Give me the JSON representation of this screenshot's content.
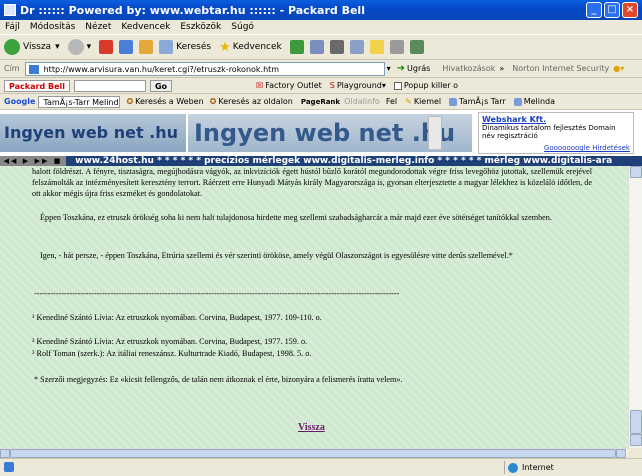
{
  "window": {
    "title": "Dr :::::: Powered by: www.webtar.hu :::::: - Packard Bell"
  },
  "menu": [
    "Fájl",
    "Módosítás",
    "Nézet",
    "Kedvencek",
    "Eszközök",
    "Súgó"
  ],
  "toolbar": {
    "back": "Vissza",
    "search": "Keresés",
    "favorites": "Kedvencek"
  },
  "address": {
    "label": "Cím",
    "url": "http://www.arvisura.van.hu/keret.cgi?/etruszk-rokonok.htm",
    "go": "Ugrás",
    "links": "Hivatkozások",
    "norton": "Norton Internet Security"
  },
  "pbbar": {
    "brand": "Packard Bell",
    "go": "Go",
    "factory": "Factory Outlet",
    "playground": "Playground",
    "popup": "Popup killer o"
  },
  "googlebar": {
    "brand": "Google",
    "select": "TamÃ¡s-Tarr Melinda",
    "web": "Keresés a Weben",
    "site": "Keresés az oldalon",
    "pagerank": "PageRank",
    "pageinfo": "Oldalinfo",
    "up": "Fel",
    "highlight": "Kiemel",
    "btn1": "TamÃ¡s Tarr",
    "btn2": "Melinda"
  },
  "banner": {
    "logo_left": "Ingyen web net .hu",
    "logo_mid": "Ingyen web net .hu",
    "ad_title": "Webshark Kft.",
    "ad_line1": "Dinamikus tartalom fejlesztés Domain",
    "ad_line2": "név regisztráció",
    "ad_footer": "Gooooooogle Hirdetések"
  },
  "ticker": "www.24host.hu * * * * * * precízios mérlegek www.digitalis-merleg.info * * * * * * mérleg www.digitalis-ara",
  "content": {
    "p1": "halott földrészt. A fényre, tisztaságra, megújhodásra vágyók, az inkvizíciók égett hústól bűzlő korától megundorodottak végre friss levegőhöz jutottak, szellemük erejével felszámolták az intézményesített keresztény terrort. Ráérzett erre Hunyadi Mátyás király Magyarországa is, gyorsan elterjesztette a magyar lélekhez is közeláló időtlen, de ott akkor mégis újra friss eszméket és gondolatokat.",
    "p2": "Éppen Toszkána, ez etruszk örökség soha ki nem halt tulajdonosa hirdette meg szellemi szabadságharcát a már majd ezer éve sötétséget tanítókkal szemben.",
    "p3": "Igen, - hát persze, - éppen Toszkána, Etrúria szellemi és vér szerinti örököse, amely végül Olaszországot is egyesülésre vitte derűs szellemével.*",
    "divider": "--------------------------------------------------------------------------------------------------------------------------------------",
    "fn1": "¹ Kenediné Szántó Lívia: Az etruszkok nyomában. Corvina, Budapest, 1977. 109-110. o.",
    "fn2": "² Kenediné Szántó Lívia: Az etruszkok nyomában. Corvina, Budapest, 1977. 159. o.",
    "fn3": "³ Rolf Toman (szerk.): Az itáliai reneszánsz. Kulturtrade Kiadó, Budapest, 1998. 5. o.",
    "note": "* Szerzői megjegyzés: Ez «kicsit fellengzős, de talán nem átkoznak el érte, bizonyára a felismerés íratta velem».",
    "back_link": "Vissza"
  },
  "status": {
    "zone": "Internet"
  }
}
